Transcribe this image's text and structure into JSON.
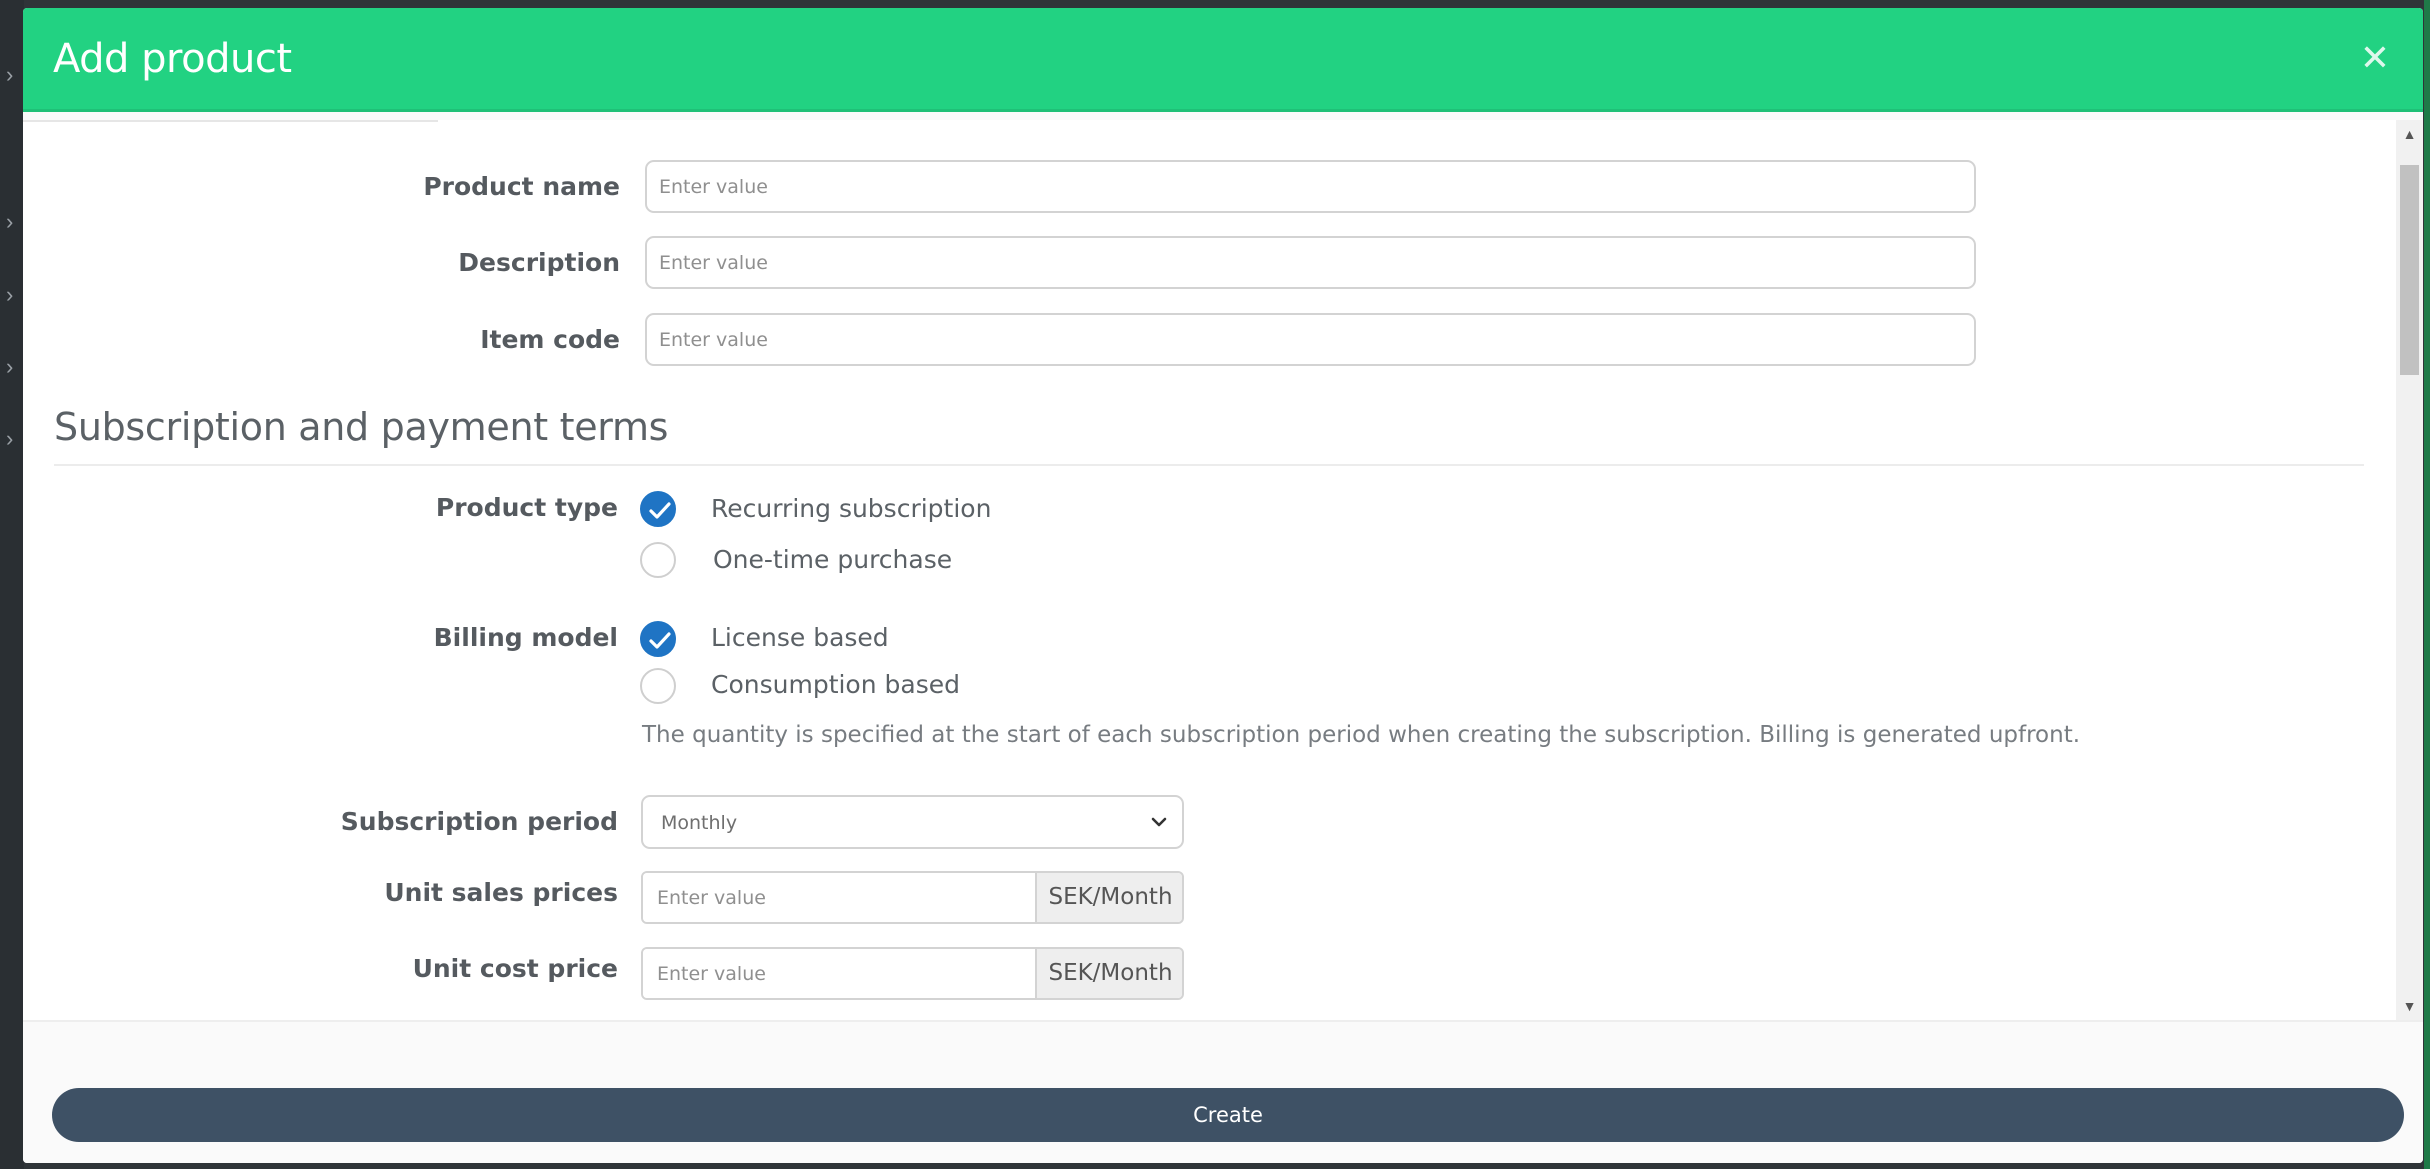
{
  "modal": {
    "title": "Add product",
    "close_icon": "close-icon"
  },
  "fields": {
    "product_name": {
      "label": "Product name",
      "placeholder": "Enter value"
    },
    "description": {
      "label": "Description",
      "placeholder": "Enter value"
    },
    "item_code": {
      "label": "Item code",
      "placeholder": "Enter value"
    }
  },
  "section": {
    "title": "Subscription and payment terms"
  },
  "product_type": {
    "label": "Product type",
    "options": [
      {
        "label": "Recurring subscription",
        "checked": true
      },
      {
        "label": "One-time purchase",
        "checked": false
      }
    ]
  },
  "billing_model": {
    "label": "Billing model",
    "options": [
      {
        "label": "License based",
        "checked": true
      },
      {
        "label": "Consumption based",
        "checked": false
      }
    ],
    "help": "The quantity is specified at the start of each subscription period when creating the subscription. Billing is generated upfront."
  },
  "subscription_period": {
    "label": "Subscription period",
    "value": "Monthly"
  },
  "unit_sales_prices": {
    "label": "Unit sales prices",
    "placeholder": "Enter value",
    "addon": "SEK/Month"
  },
  "unit_cost_price": {
    "label": "Unit cost price",
    "placeholder": "Enter value",
    "addon": "SEK/Month"
  },
  "footer": {
    "create_label": "Create"
  },
  "colors": {
    "header": "#22d282",
    "checked_radio": "#1f74c4",
    "create_button": "#3e5165"
  }
}
